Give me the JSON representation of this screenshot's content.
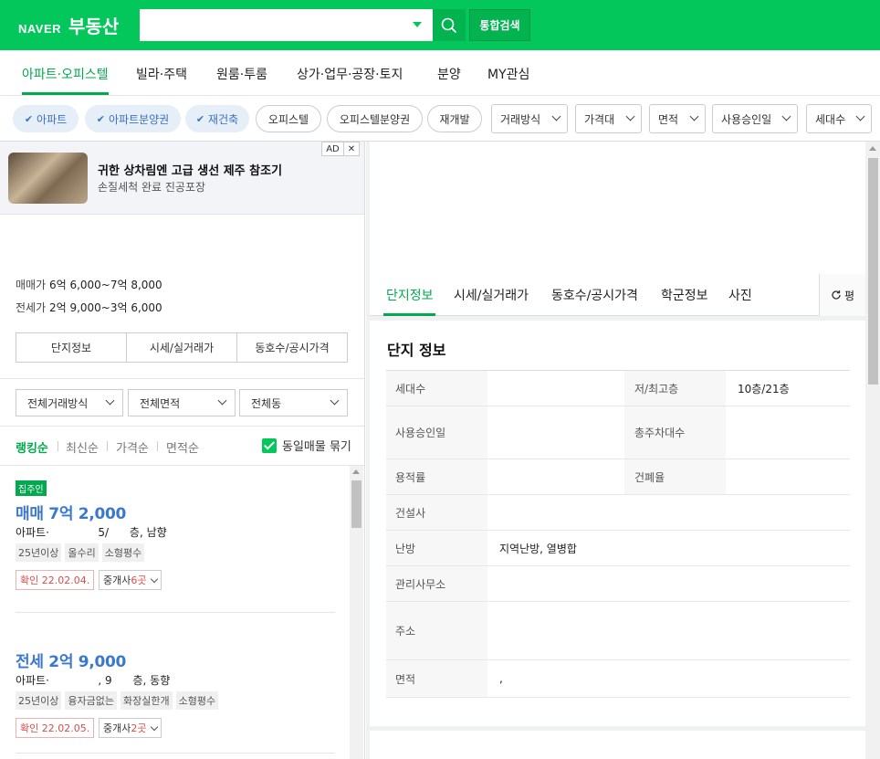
{
  "header": {
    "logo_naver": "NAVER",
    "logo_brand": "부동산",
    "search_value": "",
    "total_search_label": "통합검색",
    "brand_color": "#03c75a"
  },
  "nav": {
    "items": [
      "아파트·오피스텔",
      "빌라·주택",
      "원룸·투룸",
      "상가·업무·공장·토지",
      "분양",
      "MY관심"
    ],
    "active": "아파트·오피스텔"
  },
  "filters": {
    "chips_checked": [
      "아파트",
      "아파트분양권",
      "재건축"
    ],
    "chips_plain": [
      "오피스텔",
      "오피스텔분양권",
      "재개발"
    ],
    "dropdowns": [
      "거래방식",
      "가격대",
      "면적",
      "사용승인일",
      "세대수"
    ]
  },
  "ad": {
    "badge": "AD",
    "close": "✕",
    "title": "귀한 상차림엔 고급 생선 제주 참조기",
    "subtitle": "손질세척 완료 진공포장"
  },
  "summary": {
    "sale_label": "매매가",
    "sale_value": "6억 6,000~7억 8,000",
    "lease_label": "전세가",
    "lease_value": "2억 9,000~3억 6,000",
    "tabs": [
      "단지정보",
      "시세/실거래가",
      "동호수/공시가격"
    ]
  },
  "selects": [
    "전체거래방식",
    "전체면적",
    "전체동"
  ],
  "sort": {
    "items": [
      "랭킹순",
      "최신순",
      "가격순",
      "면적순"
    ],
    "active": "랭킹순",
    "group_label": "동일매물 묶기",
    "group_checked": true
  },
  "listings": [
    {
      "badge": "집주인",
      "price": "매매 7억 2,000",
      "type": "아파트·              5/      층, 남향",
      "tags": [
        "25년이상",
        "올수리",
        "소형평수"
      ],
      "confirmed": "확인 22.02.04.",
      "broker_label": "중개사 ",
      "broker_count": "6곳"
    },
    {
      "badge": "",
      "price": "전세 2억 9,000",
      "type": "아파트·              , 9      층, 동향",
      "tags": [
        "25년이상",
        "융자금없는",
        "화장실한개",
        "소형평수"
      ],
      "confirmed": "확인 22.02.05.",
      "broker_label": "중개사 ",
      "broker_count": "2곳"
    }
  ],
  "detail": {
    "tabs": [
      "단지정보",
      "시세/실거래가",
      "동호수/공시가격",
      "학군정보",
      "사진"
    ],
    "active_tab": "단지정보",
    "refresh_label": "평",
    "title": "단지 정보",
    "rows": [
      {
        "k": "세대수",
        "v": "",
        "k2": "저/최고층",
        "v2": "10층/21층"
      },
      {
        "k": "사용승인일",
        "v": "",
        "k2": "총주차대수",
        "v2": ""
      },
      {
        "k": "용적률",
        "v": "",
        "k2": "건폐율",
        "v2": ""
      },
      {
        "k": "건설사",
        "v": ""
      },
      {
        "k": "난방",
        "v": "지역난방, 열병합"
      },
      {
        "k": "관리사무소",
        "v": ""
      },
      {
        "k": "주소",
        "v": ""
      },
      {
        "k": "면적",
        "v": ","
      }
    ]
  }
}
